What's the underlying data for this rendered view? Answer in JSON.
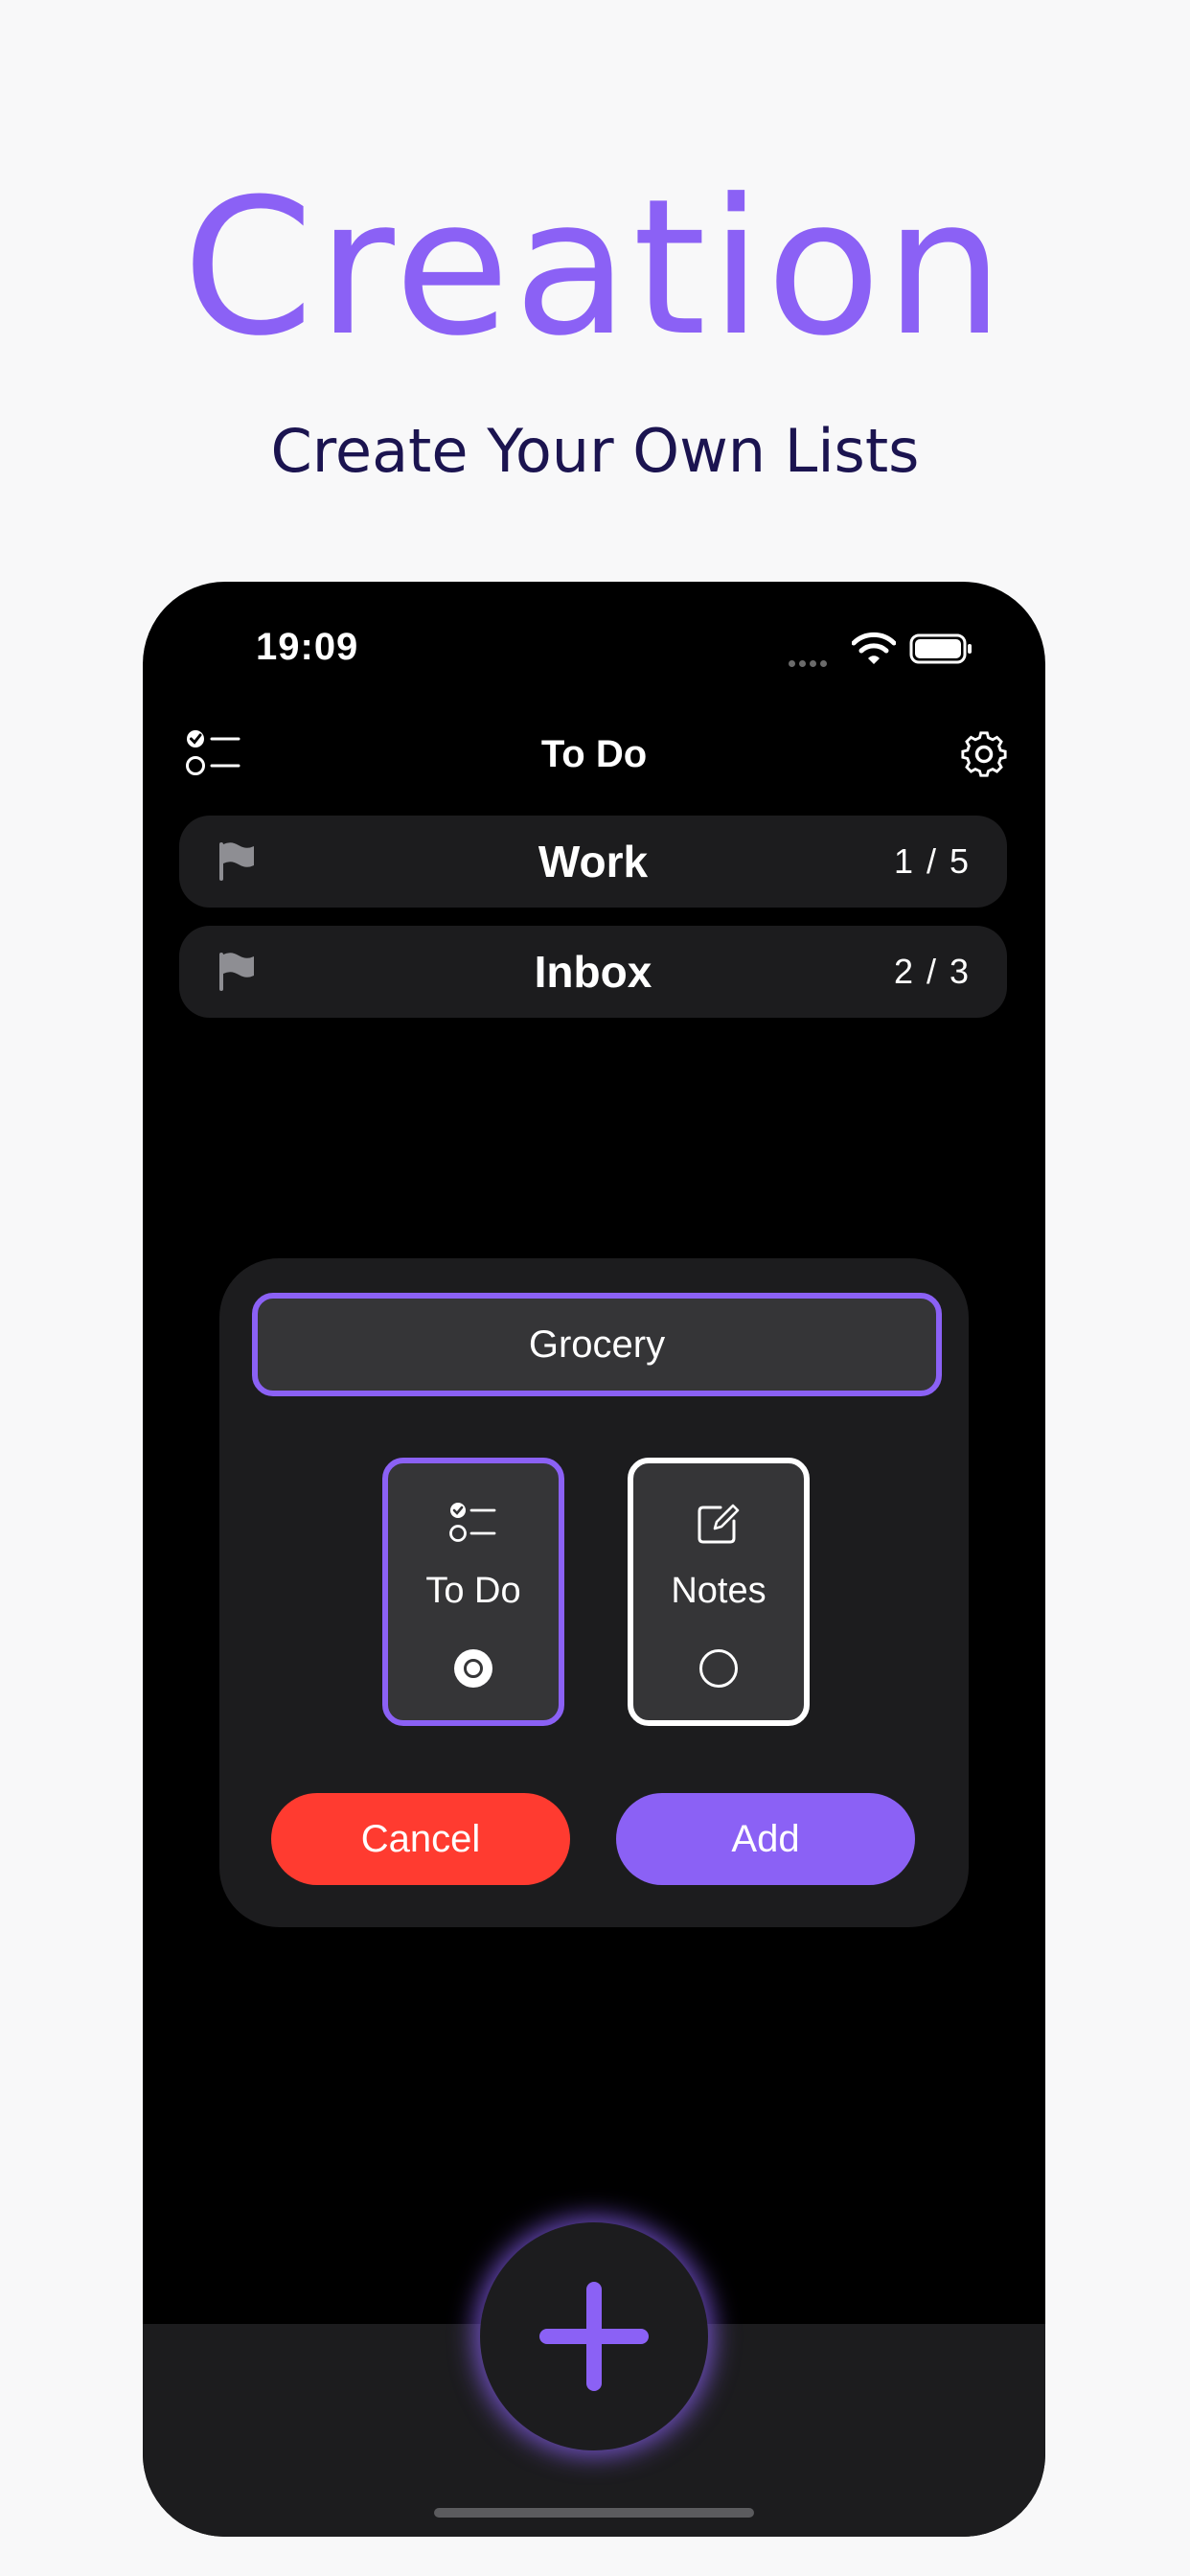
{
  "promo": {
    "title": "Creation",
    "subtitle": "Create Your Own Lists"
  },
  "status_bar": {
    "time": "19:09",
    "icons": [
      "signal-dots-icon",
      "wifi-icon",
      "battery-icon"
    ]
  },
  "nav": {
    "title": "To Do",
    "left_icon": "checklist-icon",
    "right_icon": "gear-icon"
  },
  "lists": [
    {
      "name": "Work",
      "count": "1 / 5",
      "icon": "flag-icon"
    },
    {
      "name": "Inbox",
      "count": "2 / 3",
      "icon": "flag-icon"
    }
  ],
  "dialog": {
    "name_value": "Grocery",
    "types": [
      {
        "label": "To Do",
        "icon": "checklist-icon",
        "selected": true
      },
      {
        "label": "Notes",
        "icon": "compose-icon",
        "selected": false
      }
    ],
    "cancel_label": "Cancel",
    "add_label": "Add"
  },
  "fab": {
    "icon": "plus-icon"
  },
  "colors": {
    "accent": "#8b61f5",
    "cancel": "#ff3b30",
    "subtitle": "#1b1450",
    "surface": "#1c1c1e",
    "field": "#353537"
  }
}
